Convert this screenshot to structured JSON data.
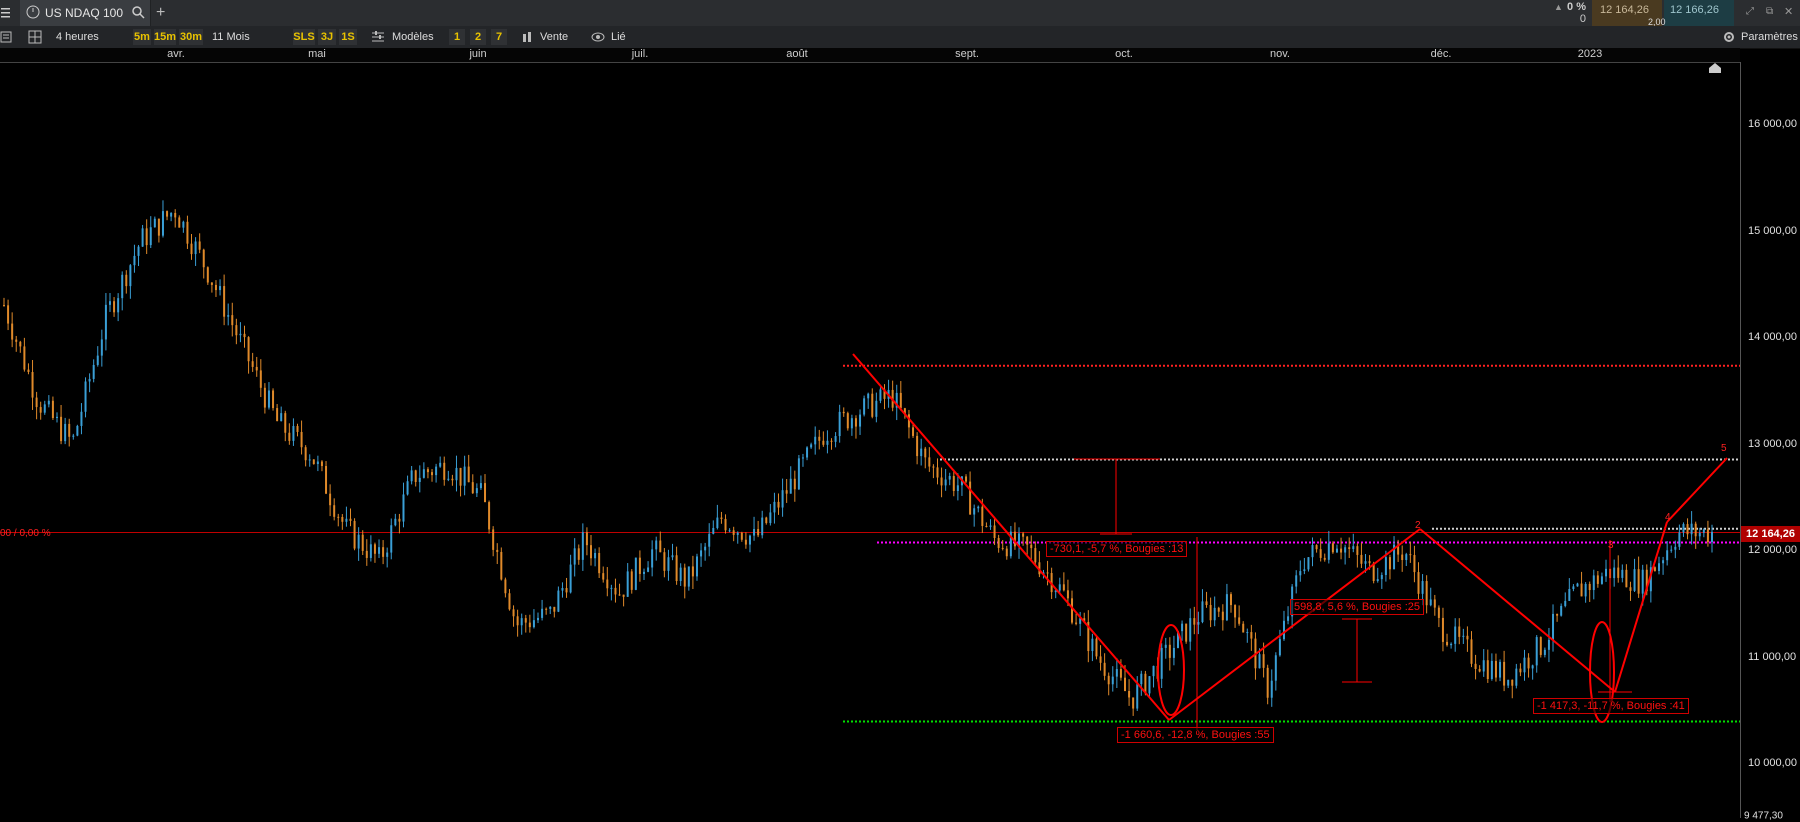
{
  "window": {
    "tab_title": "US NDAQ 100",
    "add_tab": "+",
    "change_pct": "0 %",
    "change_qty": "0",
    "bid": "12 164,26",
    "ask": "12 166,26",
    "spread": "2,00"
  },
  "toolbar": {
    "timeframe": "4 heures",
    "tf_5m": "5m",
    "tf_15m": "15m",
    "tf_30m": "30m",
    "range": "11 Mois",
    "sls": "SLS",
    "tf_3j": "3J",
    "tf_1s": "1S",
    "models": "Modèles",
    "n1": "1",
    "n2": "2",
    "n7": "7",
    "sell": "Vente",
    "linked": "Lié",
    "settings": "Paramètres"
  },
  "chart_data": {
    "type": "candlestick",
    "instrument": "US NDAQ 100",
    "interval": "4 heures",
    "x_labels": [
      "avr.",
      "mai",
      "juin",
      "juil.",
      "août",
      "sept.",
      "oct.",
      "nov.",
      "déc.",
      "2023"
    ],
    "y_ticks": [
      {
        "value": 16000,
        "label": "16 000,00"
      },
      {
        "value": 15000,
        "label": "15 000,00"
      },
      {
        "value": 14000,
        "label": "14 000,00"
      },
      {
        "value": 13000,
        "label": "13 000,00"
      },
      {
        "value": 12000,
        "label": "12 000,00"
      },
      {
        "value": 11000,
        "label": "11 000,00"
      },
      {
        "value": 10000,
        "label": "10 000,00"
      }
    ],
    "y_min_label": "9 477,30",
    "ylim": [
      9477.3,
      16550
    ],
    "last_price": 12164.26,
    "last_price_label": "12 164,26",
    "left_label": "00 / 0,00 %",
    "close_path": [
      [
        0,
        14300
      ],
      [
        0.02,
        13400
      ],
      [
        0.04,
        13000
      ],
      [
        0.06,
        14200
      ],
      [
        0.08,
        14900
      ],
      [
        0.1,
        15200
      ],
      [
        0.12,
        14600
      ],
      [
        0.14,
        13900
      ],
      [
        0.16,
        13200
      ],
      [
        0.18,
        12900
      ],
      [
        0.2,
        12200
      ],
      [
        0.22,
        11900
      ],
      [
        0.24,
        12700
      ],
      [
        0.26,
        12800
      ],
      [
        0.28,
        12500
      ],
      [
        0.3,
        11300
      ],
      [
        0.32,
        11400
      ],
      [
        0.34,
        12100
      ],
      [
        0.36,
        11600
      ],
      [
        0.38,
        12000
      ],
      [
        0.4,
        11700
      ],
      [
        0.42,
        12300
      ],
      [
        0.44,
        12100
      ],
      [
        0.46,
        12600
      ],
      [
        0.48,
        13100
      ],
      [
        0.5,
        13300
      ],
      [
        0.52,
        13450
      ],
      [
        0.54,
        12800
      ],
      [
        0.56,
        12600
      ],
      [
        0.58,
        12100
      ],
      [
        0.6,
        12000
      ],
      [
        0.62,
        11600
      ],
      [
        0.64,
        11000
      ],
      [
        0.66,
        10600
      ],
      [
        0.68,
        11000
      ],
      [
        0.7,
        11400
      ],
      [
        0.72,
        11500
      ],
      [
        0.74,
        10700
      ],
      [
        0.76,
        11900
      ],
      [
        0.78,
        12100
      ],
      [
        0.8,
        11800
      ],
      [
        0.82,
        12000
      ],
      [
        0.84,
        11300
      ],
      [
        0.86,
        11000
      ],
      [
        0.88,
        10800
      ],
      [
        0.9,
        11100
      ],
      [
        0.92,
        11600
      ],
      [
        0.94,
        11800
      ],
      [
        0.96,
        11700
      ],
      [
        0.98,
        12164
      ]
    ],
    "horizontal_levels": [
      {
        "value": 13730,
        "style": "dotted",
        "color": "#ff2020"
      },
      {
        "value": 12850,
        "style": "dotted",
        "color": "#d0d0d0"
      },
      {
        "value": 12200,
        "style": "dotted",
        "color": "#d0d0d0"
      },
      {
        "value": 12164,
        "style": "solid",
        "color": "#c00000"
      },
      {
        "value": 12070,
        "style": "dotted",
        "color": "#ff00ff"
      },
      {
        "value": 10390,
        "style": "dotted",
        "color": "#00e000"
      }
    ],
    "annotations": [
      {
        "text": "-730,1, -5,7 %, Bougies :13"
      },
      {
        "text": "598,8, 5,6 %, Bougies :25"
      },
      {
        "text": "-1 660,6, -12,8 %, Bougies :55"
      },
      {
        "text": "-1 417,3, -11,7 %, Bougies :41"
      }
    ],
    "wave_labels": [
      "2",
      "3",
      "4",
      "5"
    ]
  }
}
